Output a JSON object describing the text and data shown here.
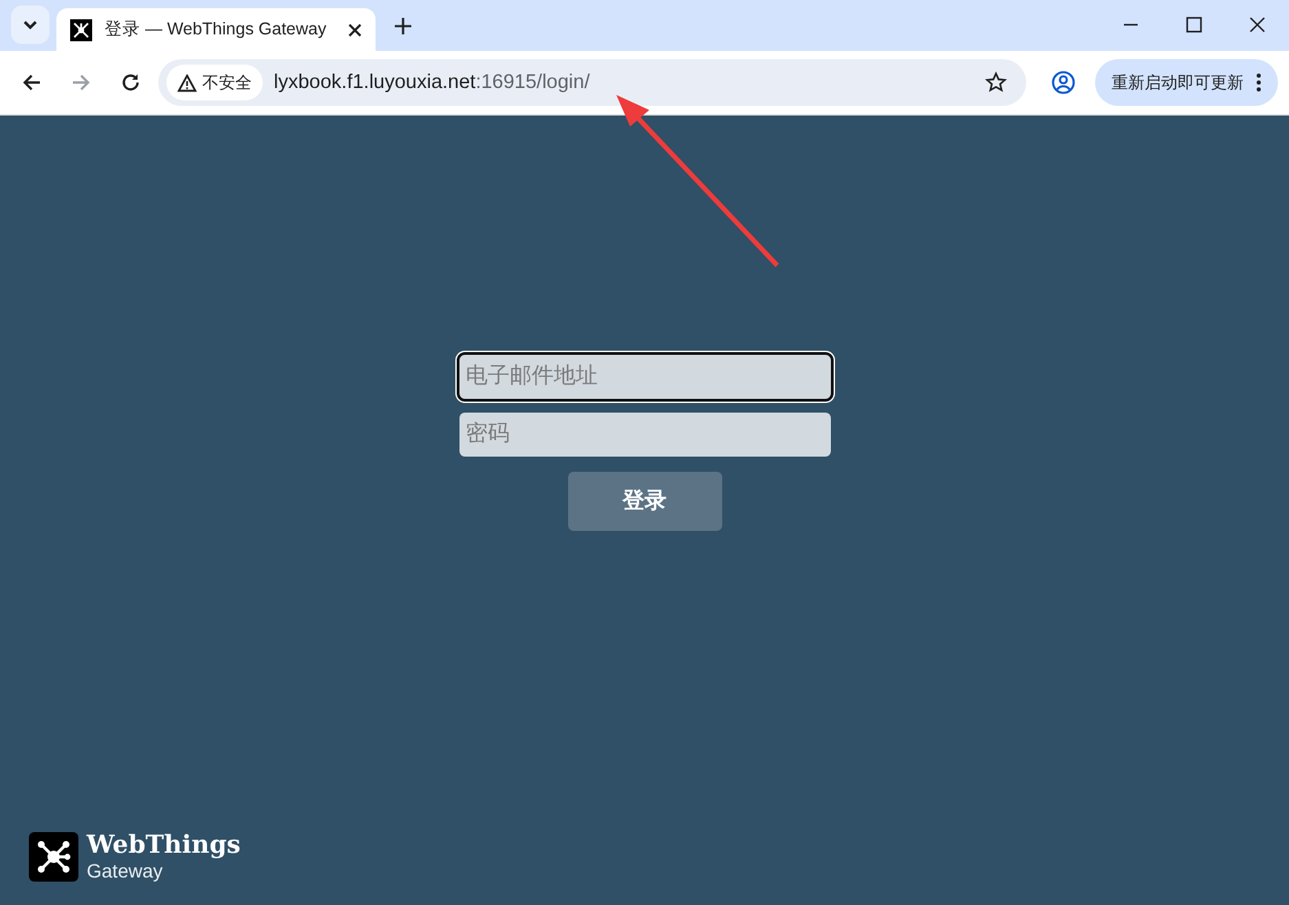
{
  "browser": {
    "tab": {
      "title": "登录 — WebThings Gateway"
    },
    "security_label": "不安全",
    "url": {
      "host": "lyxbook.f1.luyouxia.net",
      "rest": ":16915/login/"
    },
    "update_button": "重新启动即可更新"
  },
  "login": {
    "fields": [
      {
        "placeholder": "电子邮件地址",
        "focused": true
      },
      {
        "placeholder": "密码",
        "focused": false
      }
    ],
    "submit": "登录"
  },
  "logo": {
    "title": "WebThings",
    "subtitle": "Gateway"
  }
}
